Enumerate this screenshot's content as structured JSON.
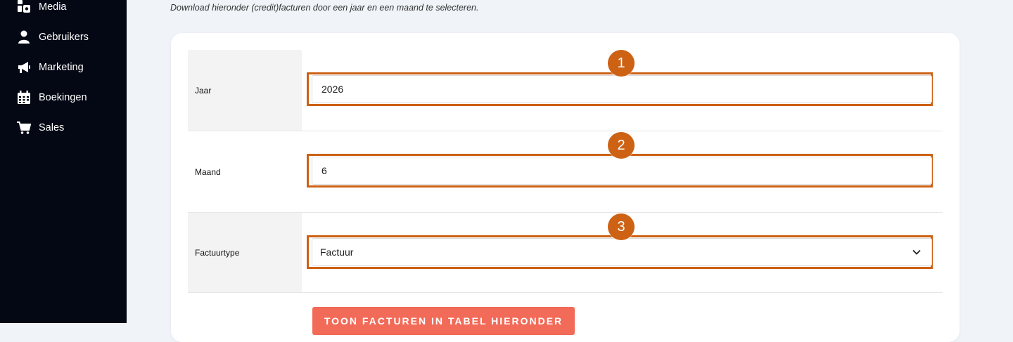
{
  "sidebar": {
    "items": [
      {
        "label": "Media",
        "icon": "media-icon"
      },
      {
        "label": "Gebruikers",
        "icon": "user-icon"
      },
      {
        "label": "Marketing",
        "icon": "megaphone-icon"
      },
      {
        "label": "Boekingen",
        "icon": "calendar-icon"
      },
      {
        "label": "Sales",
        "icon": "cart-icon"
      }
    ]
  },
  "intro": "Download hieronder (credit)facturen door een jaar en een maand te selecteren.",
  "form": {
    "year": {
      "label": "Jaar",
      "value": "2026"
    },
    "month": {
      "label": "Maand",
      "value": "6"
    },
    "invoice_type": {
      "label": "Factuurtype",
      "value": "Factuur"
    }
  },
  "markers": [
    "1",
    "2",
    "3"
  ],
  "submit_label": "TOON FACTUREN IN TABEL HIERONDER",
  "colors": {
    "sidebar_bg": "#040814",
    "highlight": "#cd6114",
    "button": "#f26a58",
    "page_bg": "#f0f3f8"
  }
}
